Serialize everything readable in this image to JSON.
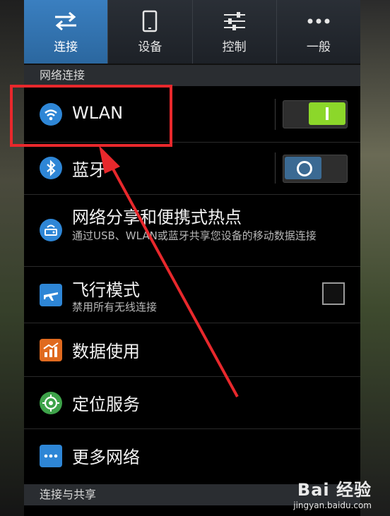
{
  "tabs": [
    {
      "label": "连接",
      "icon": "swap-arrows-icon",
      "active": true
    },
    {
      "label": "设备",
      "icon": "phone-device-icon",
      "active": false
    },
    {
      "label": "控制",
      "icon": "sliders-icon",
      "active": false
    },
    {
      "label": "一般",
      "icon": "more-dots-icon",
      "active": false
    }
  ],
  "section1": {
    "header": "网络连接"
  },
  "rows": {
    "wlan": {
      "title": "WLAN",
      "icon": "wifi-icon",
      "toggle": "on"
    },
    "bluetooth": {
      "title": "蓝牙",
      "icon": "bluetooth-icon",
      "toggle": "off"
    },
    "hotspot": {
      "title": "网络分享和便携式热点",
      "subtitle": "通过USB、WLAN或蓝牙共享您设备的移动数据连接",
      "icon": "router-icon"
    },
    "airplane": {
      "title": "飞行模式",
      "subtitle": "禁用所有无线连接",
      "icon": "airplane-icon",
      "checked": false
    },
    "data_usage": {
      "title": "数据使用",
      "icon": "data-usage-chart-icon"
    },
    "location": {
      "title": "定位服务",
      "icon": "location-target-icon"
    },
    "more_networks": {
      "title": "更多网络",
      "icon": "more-dots-icon"
    }
  },
  "section2": {
    "header": "连接与共享"
  },
  "colors": {
    "accent_tab": "#2f73b3",
    "toggle_on": "#8cd72a",
    "toggle_off": "#3b6a93",
    "highlight": "#e8282c"
  },
  "watermark": {
    "logo": "Bai 经验",
    "url": "jingyan.baidu.com"
  }
}
